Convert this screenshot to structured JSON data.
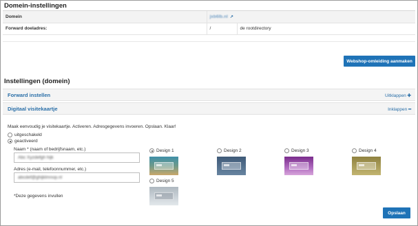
{
  "section1": {
    "title": "Domein-instellingen",
    "rows": [
      {
        "label": "Domein",
        "value": "jxb6lb.nl"
      },
      {
        "label": "Forward doeladres:",
        "value": "/",
        "extra": "de rootdirectory"
      }
    ],
    "webshop_button": "Webshop-omleiding aanmaken"
  },
  "section2": {
    "title": "Instellingen (domein)",
    "accordions": [
      {
        "title": "Forward instellen",
        "action": "Uitklappen",
        "action_icon": "plus-icon"
      },
      {
        "title": "Digitaal visitekaartje",
        "action": "Inklappen",
        "action_icon": "minus-icon"
      }
    ],
    "intro": "Maak eenvoudig je visitekaartje. Activeren. Adresgegevens invoeren. Opslaan. Klaar!",
    "status_options": [
      {
        "label": "uitgeschakeld",
        "selected": false
      },
      {
        "label": "geactiveerd",
        "selected": true
      }
    ],
    "name_label": "Naam * (naam of bedrijfsnaam, etc.)",
    "name_value": "Abc Xyzdefgh hijk",
    "address_label": "Adres (e-mail, telefoonnummer, etc.)",
    "address_value": "abcdef@ghijklmnop.nl",
    "required_note": "*Deze gegevens invullen",
    "designs": [
      {
        "label": "Design 1",
        "selected": true,
        "colors": [
          "#4c8fa0",
          "#c4a870"
        ]
      },
      {
        "label": "Design 2",
        "selected": false,
        "colors": [
          "#4a6786",
          "#5f7d98"
        ]
      },
      {
        "label": "Design 3",
        "selected": false,
        "colors": [
          "#8a3c9a",
          "#c27fc8"
        ]
      },
      {
        "label": "Design 4",
        "selected": false,
        "colors": [
          "#9c8f4c",
          "#c9bd7c"
        ]
      },
      {
        "label": "Design 5",
        "selected": false,
        "colors": [
          "#b9c2c9",
          "#dde3e7"
        ]
      }
    ],
    "save_button": "Opslaan"
  },
  "colors": {
    "accent": "#1f73b7",
    "link": "#2a6fa8"
  }
}
